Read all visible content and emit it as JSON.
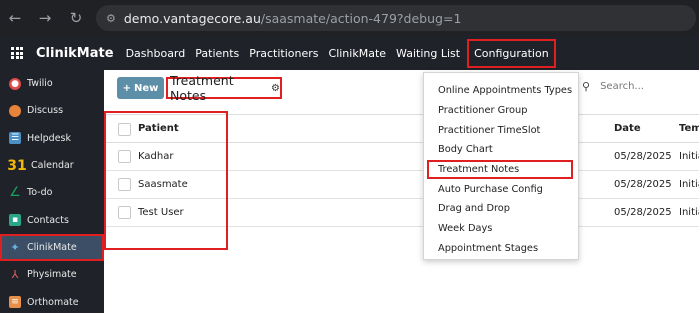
{
  "browser": {
    "url_host": "demo.vantagecore.au",
    "url_path": "/saasmate/action-479?debug=1"
  },
  "app": {
    "brand": "ClinikMate",
    "menu": [
      "Dashboard",
      "Patients",
      "Practitioners",
      "ClinikMate",
      "Waiting List",
      "Configuration"
    ]
  },
  "sidebar": {
    "items": [
      {
        "label": "Twilio",
        "icon": "twilio-icon",
        "color": "#e04a4a"
      },
      {
        "label": "Discuss",
        "icon": "discuss-icon",
        "color": "#e8833a"
      },
      {
        "label": "Helpdesk",
        "icon": "helpdesk-icon",
        "color": "#4a90c4"
      },
      {
        "label": "Calendar",
        "icon": "calendar-icon",
        "color": "#f2b807"
      },
      {
        "label": "To-do",
        "icon": "todo-icon",
        "color": "#1aa260"
      },
      {
        "label": "Contacts",
        "icon": "contacts-icon",
        "color": "#2aa58a"
      },
      {
        "label": "ClinikMate",
        "icon": "clinikmate-icon",
        "color": "#6ab0e0"
      },
      {
        "label": "Physimate",
        "icon": "physimate-icon",
        "color": "#e06060"
      },
      {
        "label": "Orthomate",
        "icon": "orthomate-icon",
        "color": "#e8904a"
      }
    ]
  },
  "controls": {
    "new_label": "New",
    "view_title": "Treatment Notes",
    "search_placeholder": "Search..."
  },
  "table": {
    "columns": [
      "Patient",
      "Date",
      "Tem"
    ],
    "rows": [
      {
        "patient": "Kadhar",
        "date": "05/28/2025",
        "template": "Initia"
      },
      {
        "patient": "Saasmate",
        "date": "05/28/2025",
        "template": "Initia"
      },
      {
        "patient": "Test User",
        "date": "05/28/2025",
        "template": "Initia"
      }
    ]
  },
  "config_dropdown": {
    "items": [
      "Online Appointments Types",
      "Practitioner Group",
      "Practitioner TimeSlot",
      "Body Chart",
      "Treatment Notes",
      "Auto Purchase Config",
      "Drag and Drop",
      "Week Days",
      "Appointment Stages"
    ],
    "selected": "Treatment Notes"
  }
}
